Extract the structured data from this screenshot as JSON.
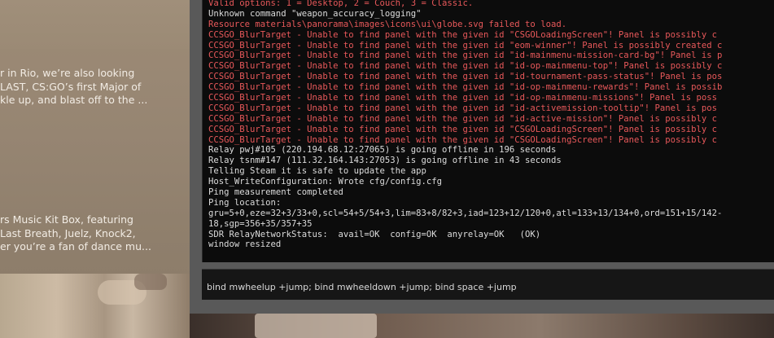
{
  "news": {
    "item1_lines": [
      "r in Rio, we’re also looking",
      "LAST, CS:GO’s first Major of",
      "kle up, and blast off to the ..."
    ],
    "item2_lines": [
      "rs Music Kit Box, featuring",
      "Last Breath, Juelz, Knock2,",
      "er you’re a fan of dance mu..."
    ]
  },
  "console": {
    "log": [
      {
        "text": "Valid options: 1 = Desktop, 2 = Couch, 3 = Classic.",
        "kind": "err"
      },
      {
        "text": "Unknown command \"weapon_accuracy_logging\"",
        "kind": "normal"
      },
      {
        "text": "Resource materials\\panorama\\images\\icons\\ui\\globe.svg failed to load.",
        "kind": "err"
      },
      {
        "text": "CCSGO_BlurTarget - Unable to find panel with the given id \"CSGOLoadingScreen\"! Panel is possibly c",
        "kind": "err"
      },
      {
        "text": "CCSGO_BlurTarget - Unable to find panel with the given id \"eom-winner\"! Panel is possibly created c",
        "kind": "err"
      },
      {
        "text": "CCSGO_BlurTarget - Unable to find panel with the given id \"id-mainmenu-mission-card-bg\"! Panel is p",
        "kind": "err"
      },
      {
        "text": "CCSGO_BlurTarget - Unable to find panel with the given id \"id-op-mainmenu-top\"! Panel is possibly c",
        "kind": "err"
      },
      {
        "text": "CCSGO_BlurTarget - Unable to find panel with the given id \"id-tournament-pass-status\"! Panel is pos",
        "kind": "err"
      },
      {
        "text": "CCSGO_BlurTarget - Unable to find panel with the given id \"id-op-mainmenu-rewards\"! Panel is possib",
        "kind": "err"
      },
      {
        "text": "CCSGO_BlurTarget - Unable to find panel with the given id \"id-op-mainmenu-missions\"! Panel is poss",
        "kind": "err"
      },
      {
        "text": "CCSGO_BlurTarget - Unable to find panel with the given id \"id-activemission-tooltip\"! Panel is pos",
        "kind": "err"
      },
      {
        "text": "CCSGO_BlurTarget - Unable to find panel with the given id \"id-active-mission\"! Panel is possibly c",
        "kind": "err"
      },
      {
        "text": "CCSGO_BlurTarget - Unable to find panel with the given id \"CSGOLoadingScreen\"! Panel is possibly c",
        "kind": "err"
      },
      {
        "text": "CCSGO_BlurTarget - Unable to find panel with the given id \"CSGOLoadingScreen\"! Panel is possibly c",
        "kind": "err"
      },
      {
        "text": "Relay pwj#105 (220.194.68.12:27065) is going offline in 196 seconds",
        "kind": "normal"
      },
      {
        "text": "Relay tsnm#147 (111.32.164.143:27053) is going offline in 43 seconds",
        "kind": "normal"
      },
      {
        "text": "Telling Steam it is safe to update the app",
        "kind": "normal"
      },
      {
        "text": "Host_WriteConfiguration: Wrote cfg/config.cfg",
        "kind": "normal"
      },
      {
        "text": "Ping measurement completed",
        "kind": "normal"
      },
      {
        "text": "Ping location:",
        "kind": "normal"
      },
      {
        "text": "gru=5+0,eze=32+3/33+0,scl=54+5/54+3,lim=83+8/82+3,iad=123+12/120+0,atl=133+13/134+0,ord=151+15/142-",
        "kind": "normal"
      },
      {
        "text": "18,sgp=356+35/357+35",
        "kind": "normal"
      },
      {
        "text": "SDR RelayNetworkStatus:  avail=OK  config=OK  anyrelay=OK   (OK)",
        "kind": "normal"
      },
      {
        "text": "window resized",
        "kind": "normal"
      }
    ],
    "command_value": "bind mwheelup +jump; bind mwheeldown +jump; bind space +jump"
  },
  "colors": {
    "error_text": "#e8585a",
    "normal_text": "#dcdcdc",
    "console_bg": "#0c0c0c",
    "frame": "#595959"
  }
}
